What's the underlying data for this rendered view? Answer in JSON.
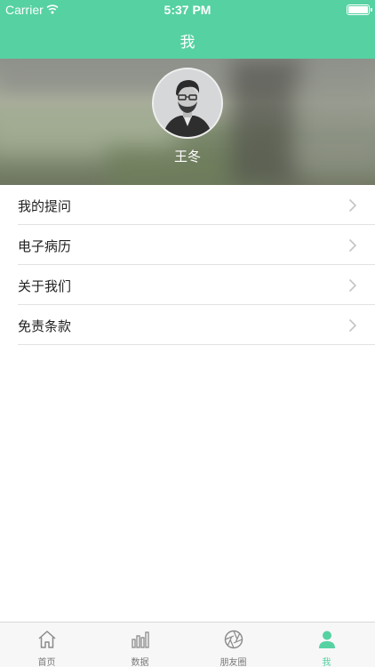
{
  "status_bar": {
    "carrier": "Carrier",
    "time": "5:37 PM"
  },
  "nav": {
    "title": "我"
  },
  "profile": {
    "name": "王冬"
  },
  "menu": [
    {
      "label": "我的提问"
    },
    {
      "label": "电子病历"
    },
    {
      "label": "关于我们"
    },
    {
      "label": "免责条款"
    }
  ],
  "tabs": [
    {
      "label": "首页",
      "icon": "home-icon"
    },
    {
      "label": "数据",
      "icon": "bar-chart-icon"
    },
    {
      "label": "朋友圈",
      "icon": "aperture-icon"
    },
    {
      "label": "我",
      "icon": "person-icon",
      "active": true
    }
  ],
  "colors": {
    "accent": "#56d1a2",
    "tab_inactive": "#7a7a7a",
    "divider": "#e2e2e2"
  }
}
